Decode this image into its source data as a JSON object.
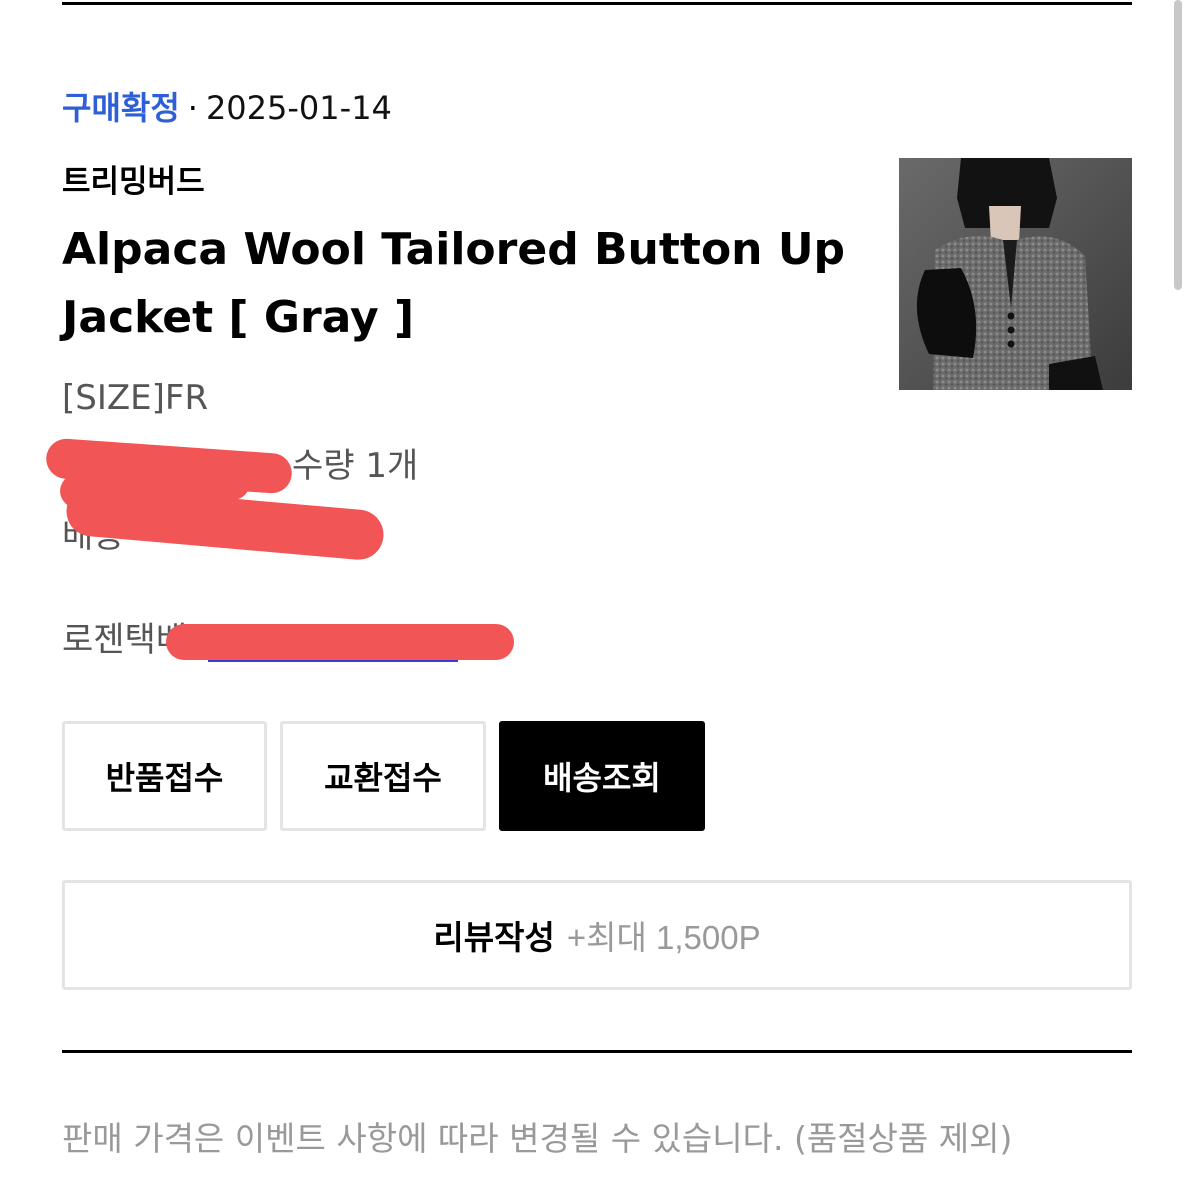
{
  "order": {
    "status_label": "구매확정",
    "separator": "·",
    "date": "2025-01-14"
  },
  "product": {
    "brand": "트리밍버드",
    "name": "Alpaca Wool Tailored Button Up Jacket [ Gray ]",
    "option": "[SIZE]FR",
    "quantity_text": "수량 1개",
    "shipping_partial": "배송",
    "courier_partial": "로젠택배"
  },
  "actions": {
    "return_label": "반품접수",
    "exchange_label": "교환접수",
    "track_label": "배송조회"
  },
  "review": {
    "label": "리뷰작성",
    "points": "+최대 1,500P"
  },
  "notice": "판매 가격은 이벤트 사항에 따라 변경될 수 있습니다. (품절상품 제외)",
  "colors": {
    "status_blue": "#2e5fd6",
    "redaction": "#f25555",
    "muted_text": "#999999",
    "tracking_link": "#3b3bd6"
  }
}
